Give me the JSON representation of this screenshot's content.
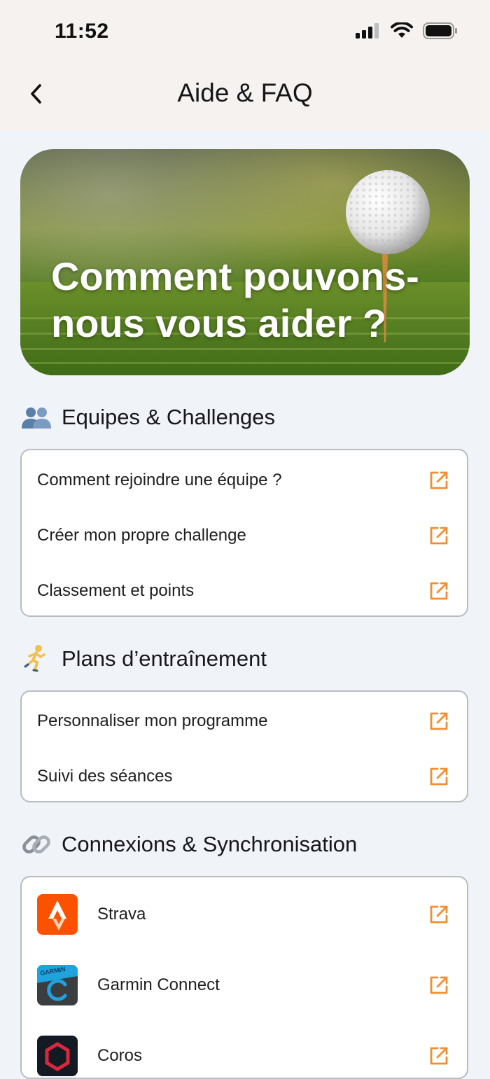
{
  "status_bar": {
    "time": "11:52"
  },
  "nav": {
    "title": "Aide & FAQ"
  },
  "hero": {
    "title": "Comment pouvons-nous vous aider ?"
  },
  "sections": [
    {
      "title": "Equipes & Challenges",
      "icon": "people-icon",
      "items": [
        {
          "label": "Comment rejoindre une équipe ?"
        },
        {
          "label": "Créer mon propre challenge"
        },
        {
          "label": "Classement et points"
        }
      ]
    },
    {
      "title": "Plans d’entraînement",
      "icon": "runner-icon",
      "items": [
        {
          "label": "Personnaliser mon programme"
        },
        {
          "label": "Suivi des séances"
        }
      ]
    },
    {
      "title": "Connexions & Synchronisation",
      "icon": "link-icon",
      "items": [
        {
          "label": "Strava",
          "logo": "strava-logo",
          "color": "#fc5200"
        },
        {
          "label": "Garmin Connect",
          "logo": "garmin-logo",
          "color": "#11a9e0",
          "logo_text": "GARMIN"
        },
        {
          "label": "Coros",
          "logo": "coros-logo",
          "color": "#d9273c"
        }
      ]
    }
  ],
  "colors": {
    "accent": "#f2902f",
    "background": "#f0f3f8",
    "card_border": "#b9bcc3"
  }
}
